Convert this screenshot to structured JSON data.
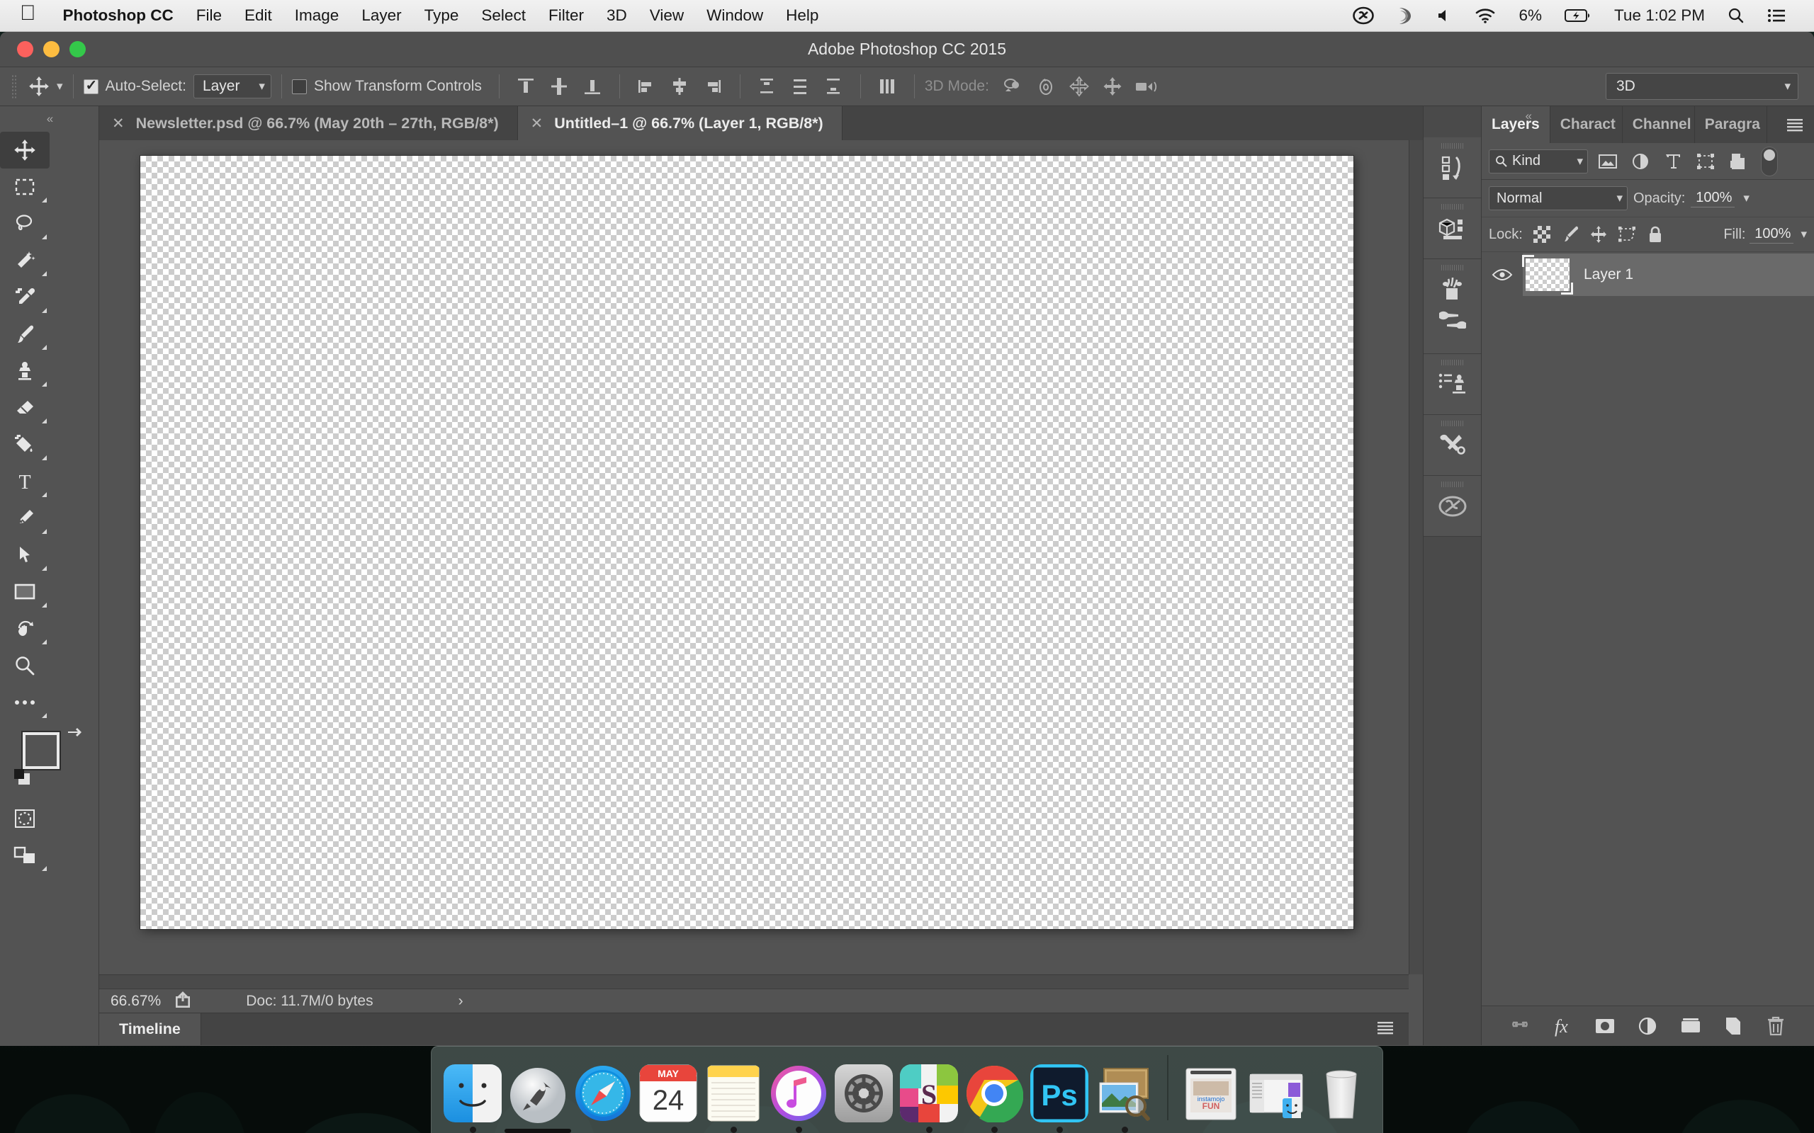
{
  "menubar": {
    "apple_icon": "apple-icon",
    "app_name": "Photoshop CC",
    "items": [
      "File",
      "Edit",
      "Image",
      "Layer",
      "Type",
      "Select",
      "Filter",
      "3D",
      "View",
      "Window",
      "Help"
    ],
    "status": {
      "creative_cloud_icon": "creative-cloud-icon",
      "dropbox_icon": "spiral-sync-icon",
      "volume_icon": "volume-icon",
      "wifi_icon": "wifi-icon",
      "battery_percent": "6%",
      "battery_icon": "battery-charging-icon",
      "clock": "Tue 1:02 PM",
      "search_icon": "search-icon",
      "notification_icon": "notification-center-icon"
    }
  },
  "window": {
    "title": "Adobe Photoshop CC 2015",
    "traffic_lights": [
      "close-button",
      "minimize-button",
      "zoom-button"
    ]
  },
  "options_bar": {
    "tool_icon": "move-tool-icon",
    "tool_preset_chevron": "chevron-down-icon",
    "auto_select_checked": true,
    "auto_select_label": "Auto-Select:",
    "auto_select_value": "Layer",
    "show_transform_checked": false,
    "show_transform_label": "Show Transform Controls",
    "align_group_1": [
      "align-top-edges-icon",
      "align-vertical-centers-icon",
      "align-bottom-edges-icon"
    ],
    "align_group_2": [
      "align-left-edges-icon",
      "align-horizontal-centers-icon",
      "align-right-edges-icon"
    ],
    "align_group_3": [
      "distribute-vertical-icon",
      "distribute-centers-icon",
      "distribute-horizontal-icon"
    ],
    "align_group_4": [
      "distribute-spacing-icon"
    ],
    "mode3d_label": "3D Mode:",
    "mode3d_icons": [
      "orbit-3d-icon",
      "roll-3d-icon",
      "pan-3d-icon",
      "slide-3d-icon",
      "camera-3d-icon"
    ],
    "workspace_value": "3D",
    "workspace_chevron": "chevron-down-icon"
  },
  "toolbar": {
    "collapse_icon": "collapse-panel-icon",
    "tools": [
      {
        "name": "move-tool",
        "icon": "move-tool-icon",
        "active": true,
        "corner": false
      },
      {
        "name": "rectangular-marquee-tool",
        "icon": "marquee-icon",
        "active": false,
        "corner": true
      },
      {
        "name": "lasso-tool",
        "icon": "lasso-icon",
        "active": false,
        "corner": true
      },
      {
        "name": "magic-wand-tool",
        "icon": "magic-wand-icon",
        "active": false,
        "corner": true
      },
      {
        "name": "eyedropper-tool",
        "icon": "eyedropper-icon",
        "active": false,
        "corner": true
      },
      {
        "name": "brush-tool",
        "icon": "brush-icon",
        "active": false,
        "corner": true
      },
      {
        "name": "clone-stamp-tool",
        "icon": "clone-stamp-icon",
        "active": false,
        "corner": true
      },
      {
        "name": "eraser-tool",
        "icon": "eraser-icon",
        "active": false,
        "corner": true
      },
      {
        "name": "gradient-tool",
        "icon": "paint-bucket-icon",
        "active": false,
        "corner": true
      },
      {
        "name": "type-tool",
        "icon": "type-tool-icon",
        "active": false,
        "corner": true
      },
      {
        "name": "pen-tool",
        "icon": "pen-tool-icon",
        "active": false,
        "corner": true
      },
      {
        "name": "path-selection-tool",
        "icon": "path-selection-icon",
        "active": false,
        "corner": true
      },
      {
        "name": "rectangle-tool",
        "icon": "rectangle-shape-icon",
        "active": false,
        "corner": true
      },
      {
        "name": "rotate-view-tool",
        "icon": "hand-rotate-icon",
        "active": false,
        "corner": true
      },
      {
        "name": "zoom-tool",
        "icon": "zoom-magnifier-icon",
        "active": false,
        "corner": false
      },
      {
        "name": "edit-toolbar",
        "icon": "ellipsis-icon",
        "active": false,
        "corner": true
      }
    ],
    "foreground_color": "#535353",
    "background_color": "#ffffff",
    "swap_icon": "swap-colors-icon",
    "default_colors_icon": "default-colors-icon",
    "quick_mask_icon": "quick-mask-icon",
    "screen_mode_icon": "screen-mode-icon"
  },
  "document_tabs": [
    {
      "close_icon": "close-icon",
      "label": "Newsletter.psd @ 66.7% (May 20th – 27th, RGB/8*)",
      "active": false
    },
    {
      "close_icon": "close-icon",
      "label": "Untitled–1 @ 66.7% (Layer 1, RGB/8*)",
      "active": true
    }
  ],
  "statusbar": {
    "zoom": "66.67%",
    "share_icon": "share-icon",
    "doc_info": "Doc: 11.7M/0 bytes",
    "expand_icon": "chevron-right-icon"
  },
  "timeline": {
    "tab_label": "Timeline",
    "menu_icon": "panel-menu-icon"
  },
  "icon_rail": {
    "collapse_icon": "collapse-panels-icon",
    "items": [
      {
        "name": "history-panel-icon"
      },
      {
        "name": "3d-panel-icon"
      },
      {
        "name": "brush-presets-panel-icon"
      },
      {
        "name": "clone-source-panel-icon"
      },
      {
        "name": "tool-presets-panel-icon"
      },
      {
        "name": "creative-cloud-libraries-icon"
      }
    ]
  },
  "layers_panel": {
    "tabs": [
      {
        "label": "Layers",
        "active": true
      },
      {
        "label": "Charact",
        "active": false
      },
      {
        "label": "Channel",
        "active": false
      },
      {
        "label": "Paragra",
        "active": false
      }
    ],
    "menu_icon": "panel-menu-icon",
    "filter": {
      "search_icon": "search-icon",
      "kind_label": "Kind",
      "chevron": "chevron-down-icon",
      "type_filters": [
        "pixel-layer-filter-icon",
        "adjustment-layer-filter-icon",
        "type-layer-filter-icon",
        "shape-layer-filter-icon",
        "smart-object-filter-icon"
      ],
      "toggle": "filter-enable-toggle"
    },
    "blend_mode": "Normal",
    "blend_chevron": "chevron-down-icon",
    "opacity_label": "Opacity:",
    "opacity_value": "100%",
    "lock_label": "Lock:",
    "lock_icons": [
      "lock-transparent-pixels-icon",
      "lock-image-pixels-icon",
      "lock-position-icon",
      "lock-artboard-icon",
      "lock-all-icon"
    ],
    "fill_label": "Fill:",
    "fill_value": "100%",
    "layers": [
      {
        "visible": true,
        "eye_icon": "eye-icon",
        "name": "Layer 1",
        "selected": true
      }
    ],
    "footer_buttons": [
      {
        "name": "link-layers-button",
        "icon": "link-icon"
      },
      {
        "name": "layer-style-button",
        "icon": "fx-icon"
      },
      {
        "name": "layer-mask-button",
        "icon": "mask-icon"
      },
      {
        "name": "adjustment-layer-button",
        "icon": "adjustment-icon"
      },
      {
        "name": "new-group-button",
        "icon": "folder-icon"
      },
      {
        "name": "new-layer-button",
        "icon": "new-layer-icon"
      },
      {
        "name": "delete-layer-button",
        "icon": "trash-icon"
      }
    ]
  },
  "dock": {
    "items": [
      {
        "name": "finder",
        "icon": "finder-icon",
        "running": true
      },
      {
        "name": "launchpad",
        "icon": "launchpad-icon",
        "running": false
      },
      {
        "name": "safari",
        "icon": "safari-icon",
        "running": false
      },
      {
        "name": "calendar",
        "icon": "calendar-icon",
        "running": false,
        "month": "MAY",
        "day": "24"
      },
      {
        "name": "notes",
        "icon": "notes-icon",
        "running": true
      },
      {
        "name": "itunes",
        "icon": "itunes-icon",
        "running": true
      },
      {
        "name": "system-preferences",
        "icon": "system-preferences-icon",
        "running": false
      },
      {
        "name": "sketch",
        "icon": "sketch-icon",
        "running": true
      },
      {
        "name": "chrome",
        "icon": "chrome-icon",
        "running": true
      },
      {
        "name": "photoshop",
        "icon": "photoshop-icon",
        "running": true,
        "label": "Ps"
      },
      {
        "name": "preview",
        "icon": "preview-icon",
        "running": true
      }
    ],
    "minimized": [
      {
        "name": "minimized-instamojo-window",
        "icon": "document-window-icon"
      },
      {
        "name": "minimized-finder-window",
        "icon": "finder-window-icon"
      }
    ],
    "trash": {
      "name": "trash",
      "icon": "trash-icon"
    }
  }
}
